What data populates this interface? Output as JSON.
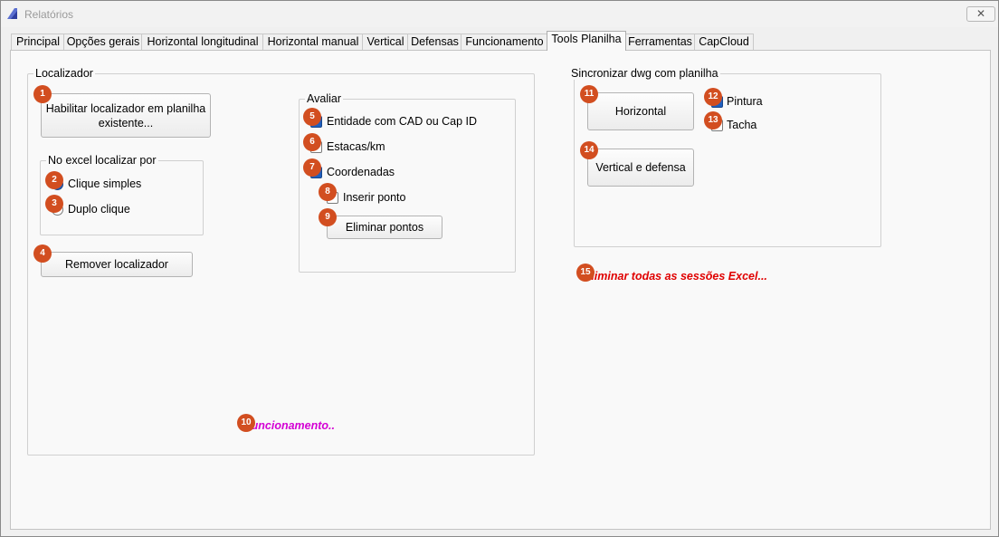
{
  "window": {
    "title": "Relatórios",
    "close_symbol": "✕"
  },
  "tabs": [
    {
      "label": "Principal"
    },
    {
      "label": "Opções gerais"
    },
    {
      "label": "Horizontal longitudinal"
    },
    {
      "label": "Horizontal manual"
    },
    {
      "label": "Vertical"
    },
    {
      "label": "Defensas"
    },
    {
      "label": "Funcionamento"
    },
    {
      "label": "Tools Planilha",
      "active": true
    },
    {
      "label": "Ferramentas"
    },
    {
      "label": "CapCloud"
    }
  ],
  "localizador": {
    "title": "Localizador",
    "habilitar_button": "Habilitar localizador em planilha existente...",
    "no_excel_title": "No excel localizar por",
    "clique_simples": {
      "label": "Clique simples",
      "selected": true
    },
    "duplo_clique": {
      "label": "Duplo clique",
      "selected": false
    },
    "remover_button": "Remover localizador",
    "avaliar": {
      "title": "Avaliar",
      "entidade": {
        "label": "Entidade com CAD ou Cap ID",
        "checked": true
      },
      "estacas": {
        "label": "Estacas/km",
        "checked": false
      },
      "coordenadas": {
        "label": "Coordenadas",
        "checked": true
      },
      "inserir_ponto": {
        "label": "Inserir ponto",
        "checked": false
      },
      "eliminar_button": "Eliminar pontos"
    },
    "funcionamento_link": "Funcionamento.."
  },
  "sincronizar": {
    "title": "Sincronizar dwg com planilha",
    "horizontal_button": "Horizontal",
    "pintura": {
      "label": "Pintura",
      "checked": true
    },
    "tacha": {
      "label": "Tacha",
      "checked": false
    },
    "vertical_button": "Vertical e defensa"
  },
  "eliminar_sessoes_link": "Eliminar todas as sessões Excel...",
  "badges": [
    "1",
    "2",
    "3",
    "4",
    "5",
    "6",
    "7",
    "8",
    "9",
    "10",
    "11",
    "12",
    "13",
    "14",
    "15"
  ],
  "colors": {
    "badge": "#d24e20",
    "magenta_link": "#d400d4",
    "red_link": "#e00000",
    "check_fill": "#1f5fbf"
  }
}
